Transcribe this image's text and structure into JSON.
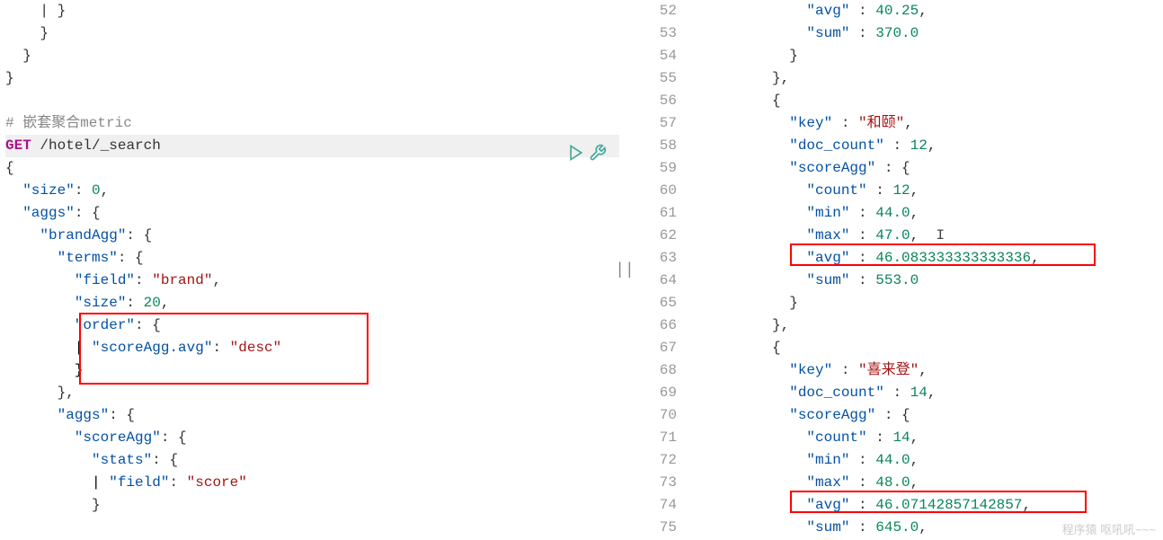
{
  "left": {
    "comment": "# 嵌套聚合metric",
    "method": "GET",
    "path": "/hotel/_search",
    "json": {
      "l1": "{",
      "l2_k": "\"size\"",
      "l2_v": "0",
      "l3_k": "\"aggs\"",
      "l4_k": "\"brandAgg\"",
      "l5_k": "\"terms\"",
      "l6_k": "\"field\"",
      "l6_v": "\"brand\"",
      "l7_k": "\"size\"",
      "l7_v": "20",
      "l8_k": "\"order\"",
      "l9_k": "\"scoreAgg.avg\"",
      "l9_v": "\"desc\"",
      "l11_k": "\"aggs\"",
      "l12_k": "\"scoreAgg\"",
      "l13_k": "\"stats\"",
      "l14_k": "\"field\"",
      "l14_v": "\"score\""
    }
  },
  "right": {
    "lines": [
      "52",
      "53",
      "54",
      "55",
      "56",
      "57",
      "58",
      "59",
      "60",
      "61",
      "62",
      "63",
      "64",
      "65",
      "66",
      "67",
      "68",
      "69",
      "70",
      "71",
      "72",
      "73",
      "74",
      "75"
    ],
    "r52_k": "\"avg\"",
    "r52_v": "40.25",
    "r53_k": "\"sum\"",
    "r53_v": "370.0",
    "r57_k": "\"key\"",
    "r57_v": "\"和颐\"",
    "r58_k": "\"doc_count\"",
    "r58_v": "12",
    "r59_k": "\"scoreAgg\"",
    "r60_k": "\"count\"",
    "r60_v": "12",
    "r61_k": "\"min\"",
    "r61_v": "44.0",
    "r62_k": "\"max\"",
    "r62_v": "47.0",
    "r63_k": "\"avg\"",
    "r63_v": "46.083333333333336",
    "r64_k": "\"sum\"",
    "r64_v": "553.0",
    "r68_k": "\"key\"",
    "r68_v": "\"喜来登\"",
    "r69_k": "\"doc_count\"",
    "r69_v": "14",
    "r70_k": "\"scoreAgg\"",
    "r71_k": "\"count\"",
    "r71_v": "14",
    "r72_k": "\"min\"",
    "r72_v": "44.0",
    "r73_k": "\"max\"",
    "r73_v": "48.0",
    "r74_k": "\"avg\"",
    "r74_v": "46.07142857142857",
    "r75_k": "\"sum\"",
    "r75_v": "645.0"
  },
  "watermark": "程序猿 呕吼吼~~~"
}
